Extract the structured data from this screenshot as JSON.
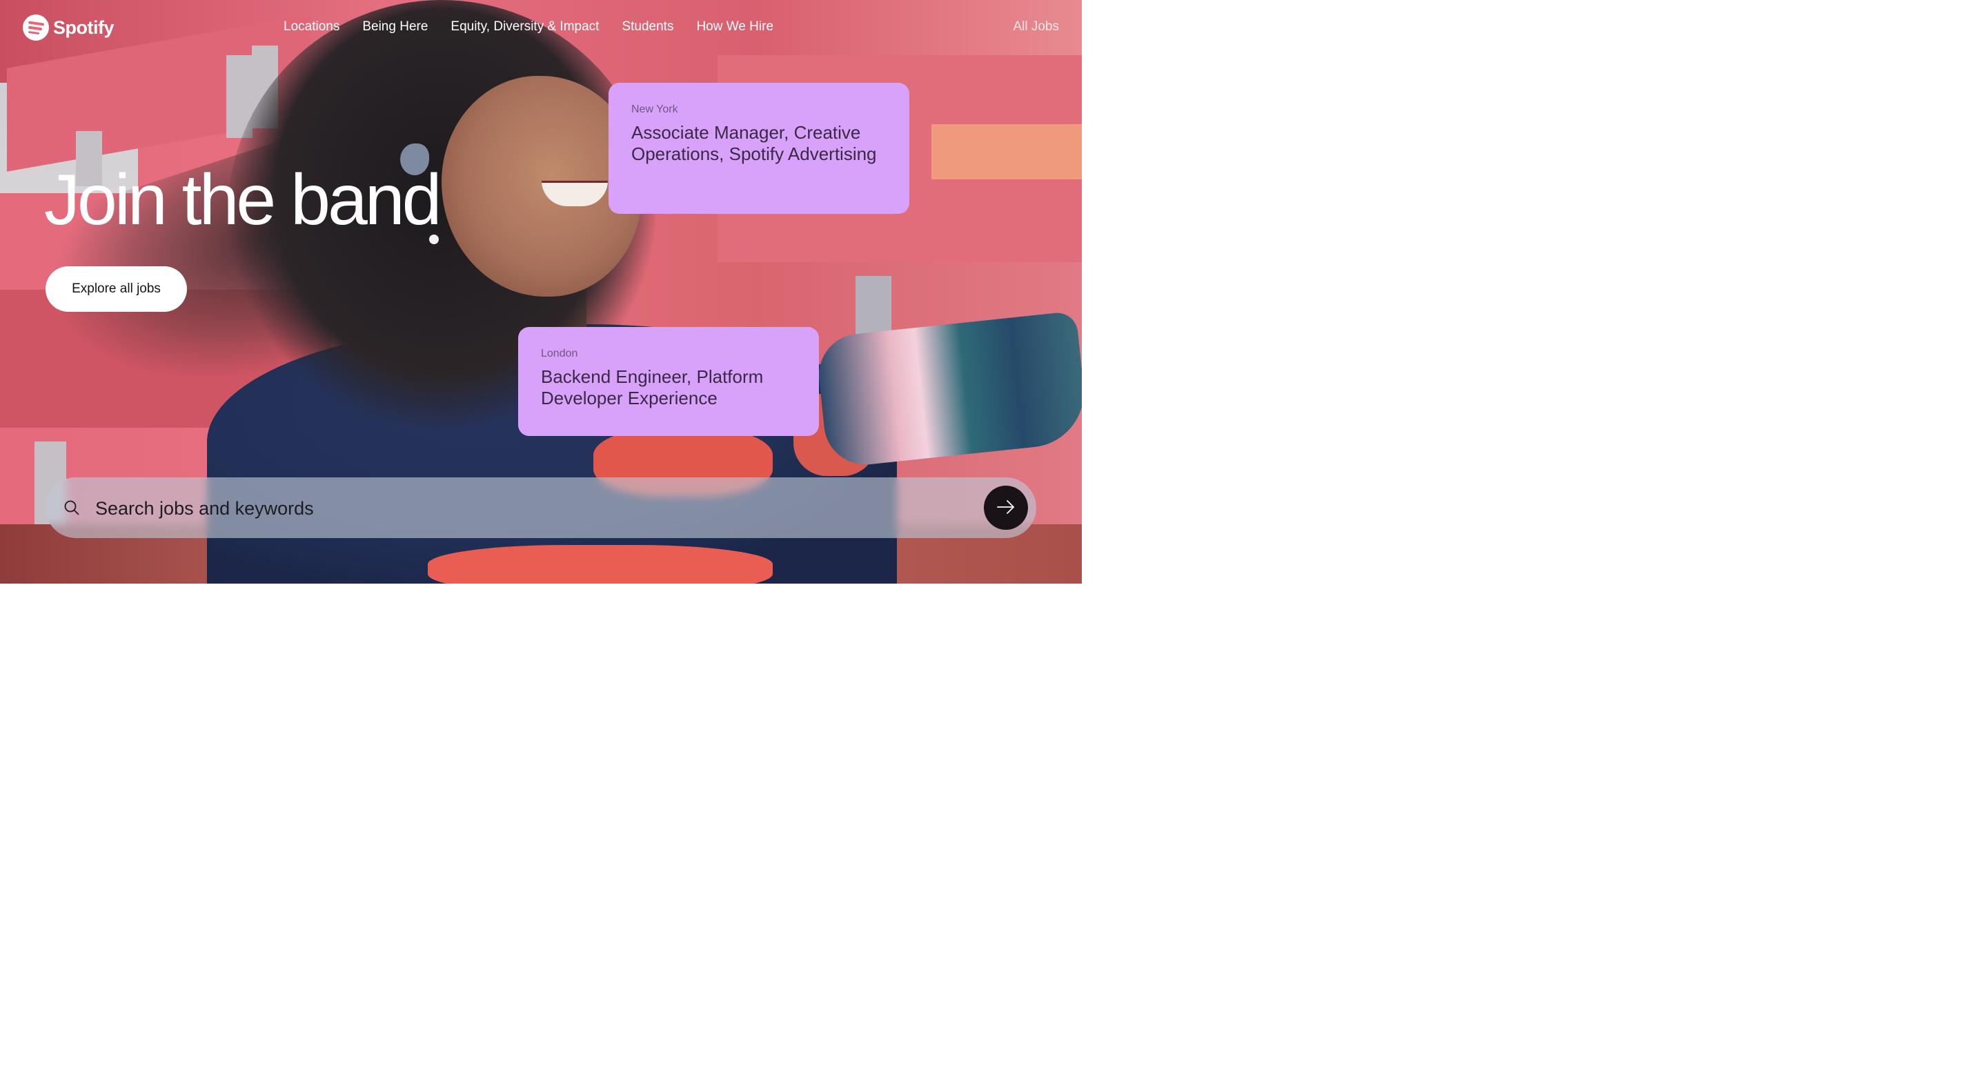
{
  "brand": {
    "name": "Spotify"
  },
  "nav": {
    "items": [
      {
        "label": "Locations"
      },
      {
        "label": "Being Here"
      },
      {
        "label": "Equity, Diversity & Impact"
      },
      {
        "label": "Students"
      },
      {
        "label": "How We Hire"
      }
    ],
    "all_jobs": "All Jobs"
  },
  "hero": {
    "title": "Join the band",
    "explore_button": "Explore all jobs"
  },
  "job_cards": [
    {
      "location": "New York",
      "title": "Associate Manager, Creative Operations, Spotify Advertising"
    },
    {
      "location": "London",
      "title": "Backend Engineer, Platform Developer Experience"
    }
  ],
  "search": {
    "placeholder": "Search jobs and keywords",
    "value": "",
    "icon": "search-icon",
    "submit_icon": "arrow-right-icon"
  },
  "colors": {
    "card_background": "#d8a2fb",
    "submit_button": "#191317",
    "hero_text": "#ffffff"
  }
}
